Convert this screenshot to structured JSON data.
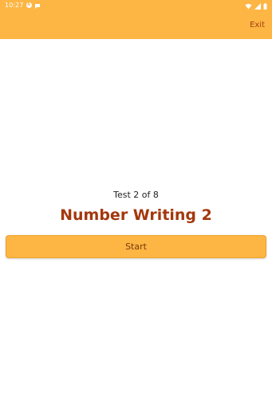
{
  "status_bar": {
    "time": "10:27",
    "icons": [
      "app-icon",
      "chat-icon",
      "wifi-icon",
      "signal-icon",
      "battery-icon"
    ]
  },
  "app_bar": {
    "exit_label": "Exit"
  },
  "main": {
    "test_counter": "Test 2 of 8",
    "test_title": "Number Writing 2",
    "start_label": "Start"
  },
  "colors": {
    "accent": "#fdb544",
    "title": "#a3380d",
    "exit_text": "#a3410f"
  }
}
